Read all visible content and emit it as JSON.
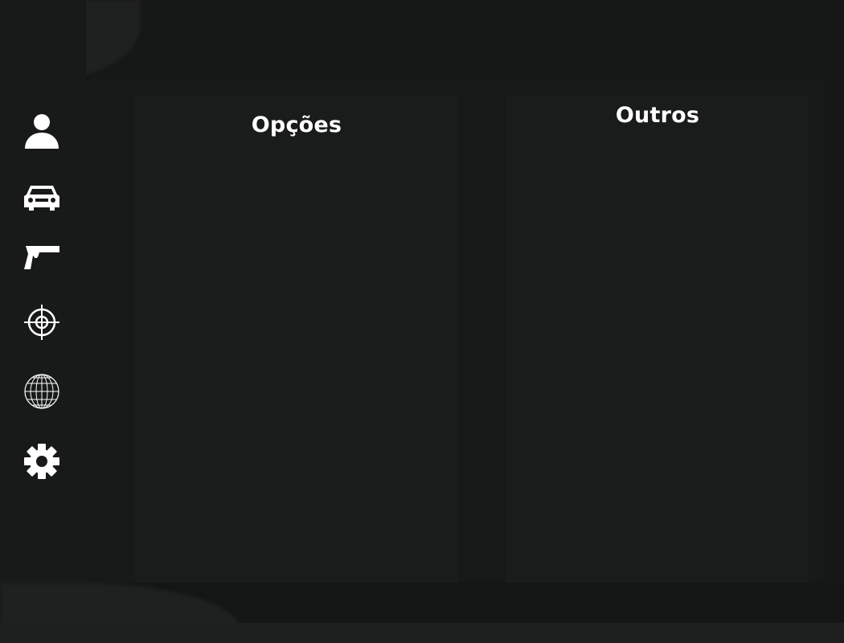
{
  "sidebar": {
    "items": [
      {
        "name": "profile",
        "icon": "user-icon"
      },
      {
        "name": "vehicles",
        "icon": "car-icon"
      },
      {
        "name": "weapons",
        "icon": "pistol-icon"
      },
      {
        "name": "target",
        "icon": "crosshair-icon"
      },
      {
        "name": "world",
        "icon": "globe-icon"
      },
      {
        "name": "settings",
        "icon": "gear-icon"
      }
    ]
  },
  "panels": {
    "left": {
      "title": "Opções"
    },
    "right": {
      "title": "Outros"
    }
  },
  "colors": {
    "background": "#161717",
    "sidebar": "#181a1a",
    "panel": "#1a1c1c",
    "text": "#ffffff",
    "accent": "#15a184"
  }
}
